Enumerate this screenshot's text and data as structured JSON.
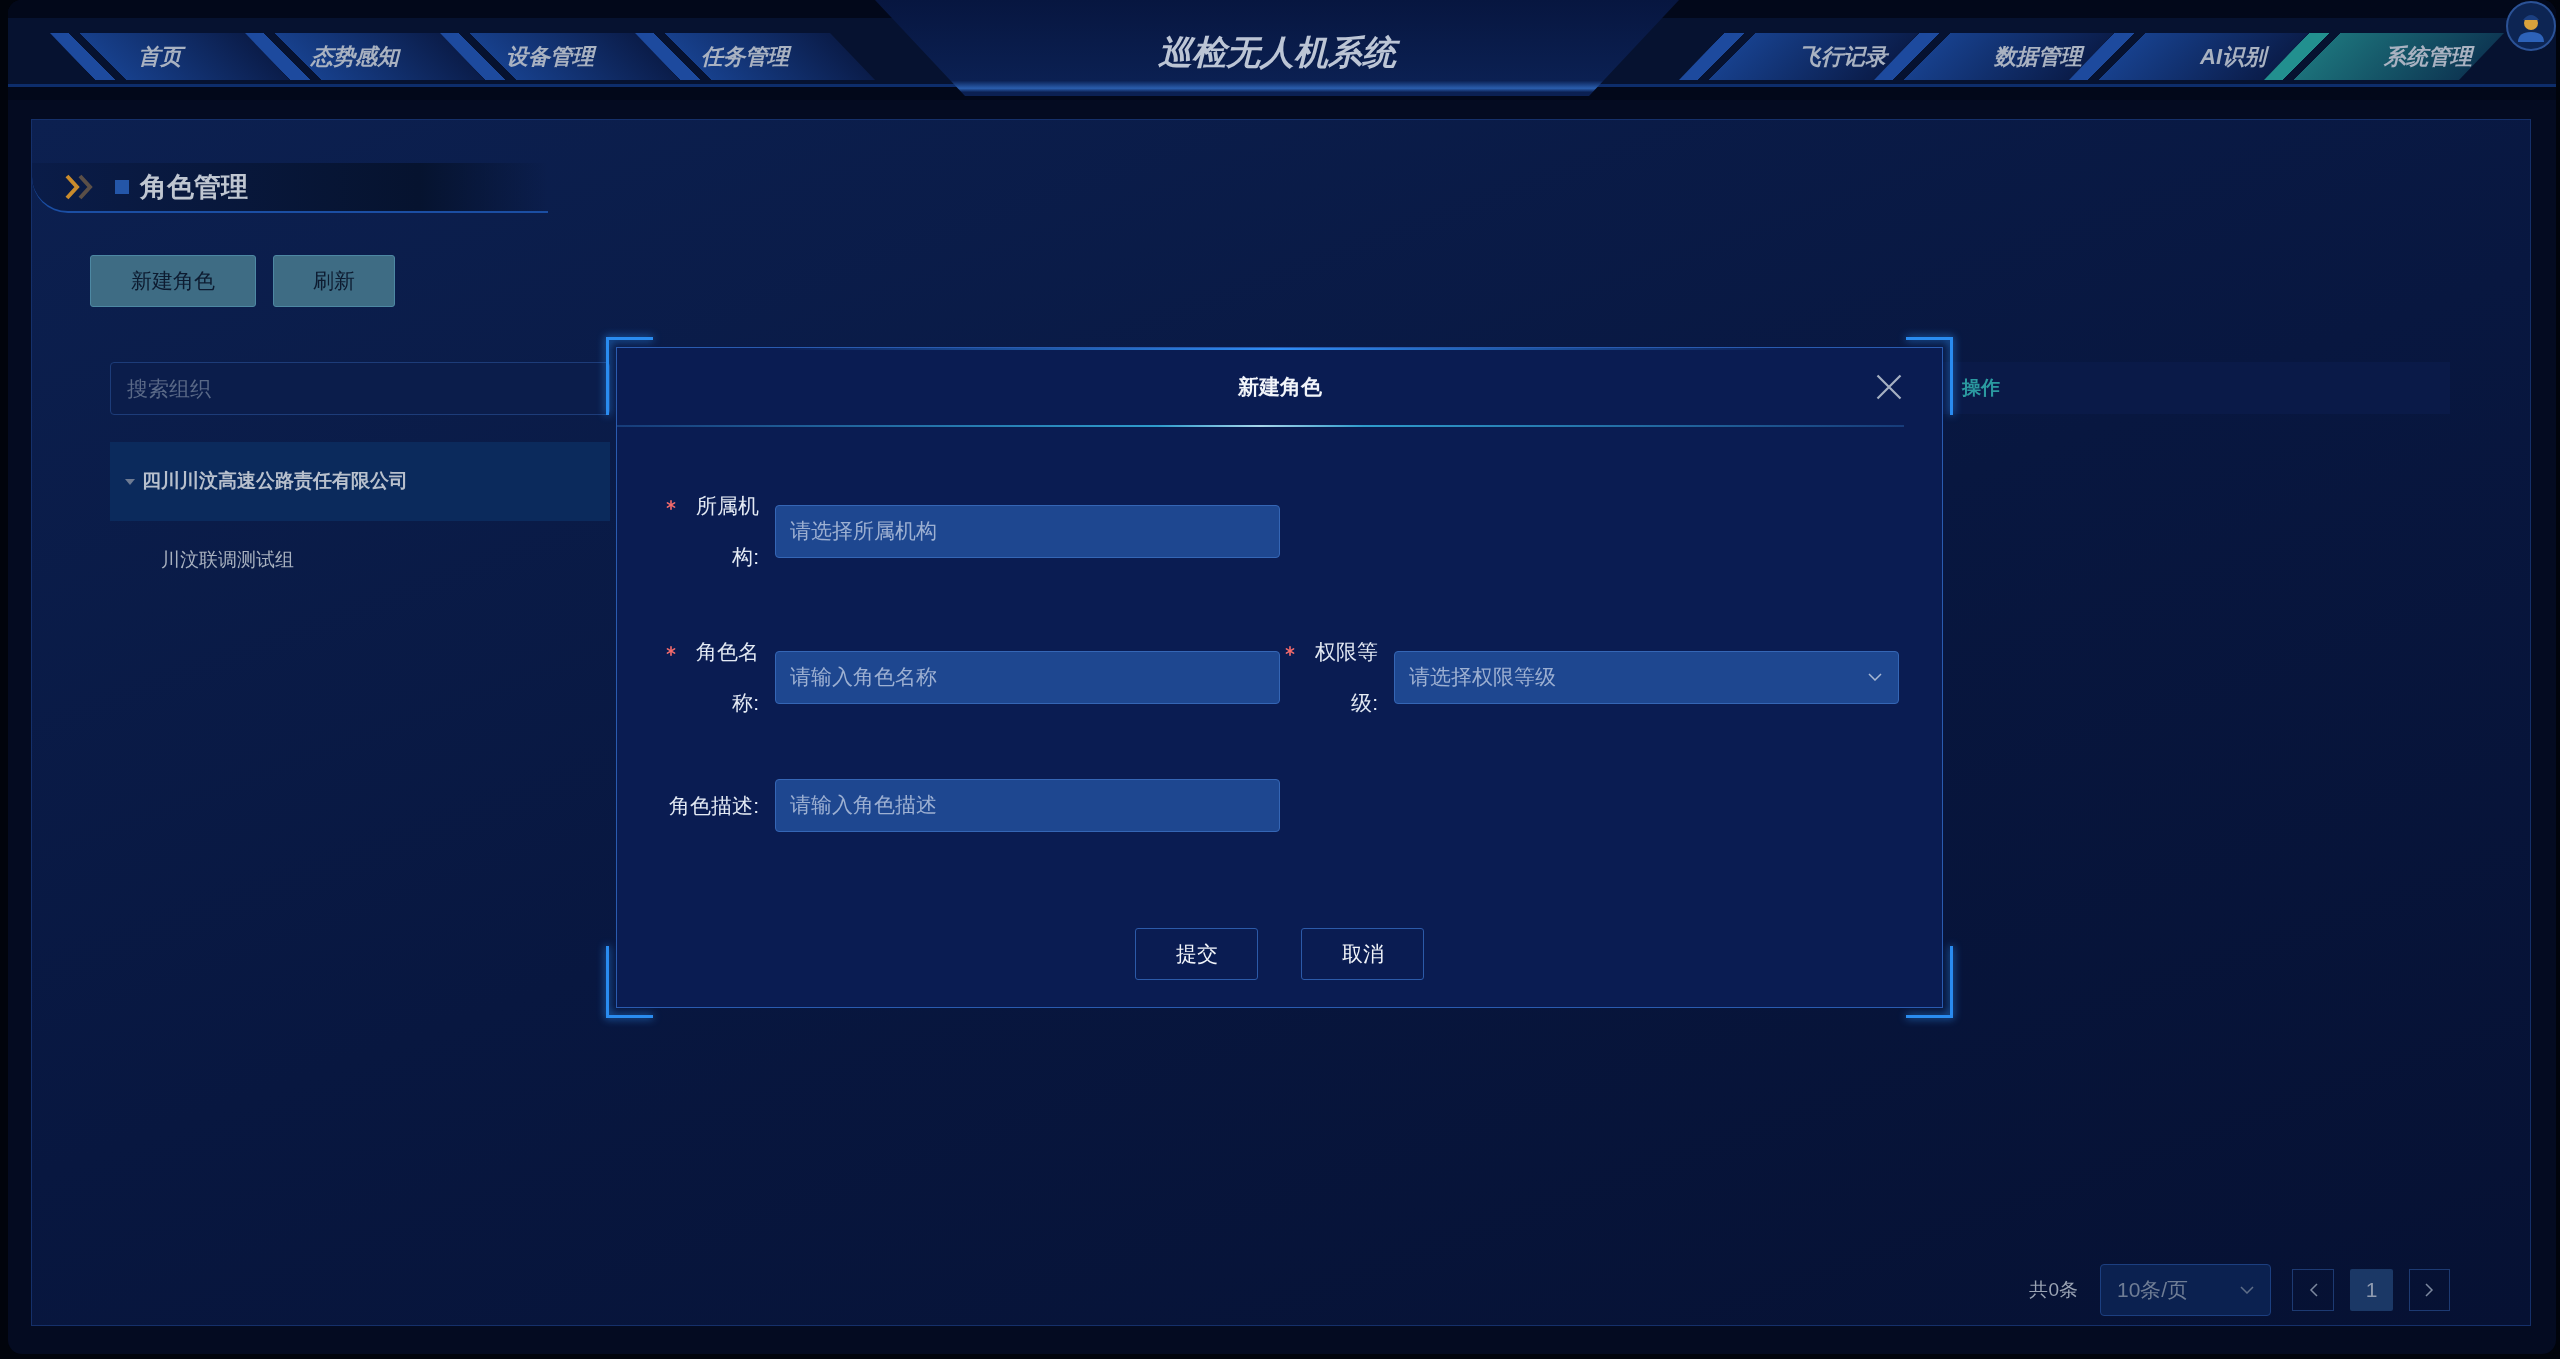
{
  "header": {
    "nav_left": [
      {
        "label": "首页",
        "selected": false
      },
      {
        "label": "态势感知",
        "selected": false
      },
      {
        "label": "设备管理",
        "selected": false
      },
      {
        "label": "任务管理",
        "selected": false
      }
    ],
    "title": "巡检无人机系统",
    "nav_right": [
      {
        "label": "飞行记录",
        "selected": false
      },
      {
        "label": "数据管理",
        "selected": false
      },
      {
        "label": "AI识别",
        "selected": false
      },
      {
        "label": "系统管理",
        "selected": true
      }
    ]
  },
  "page": {
    "title": "角色管理",
    "toolbar": [
      "新建角色",
      "刷新"
    ],
    "org_search": {
      "placeholder": "搜索组织"
    },
    "org_tree": [
      {
        "label": "四川川汶高速公路责任有限公司",
        "selected": true,
        "expanded": true,
        "children": [
          {
            "label": "川汶联调测试组",
            "selected": false
          }
        ]
      }
    ],
    "table": {
      "columns": [
        "操作"
      ]
    },
    "pagination": {
      "total": "共0条",
      "page_size": "10条/页",
      "pages": [
        {
          "label": "1",
          "selected": true
        }
      ]
    }
  },
  "dialog": {
    "title": "新建角色",
    "rows": [
      {
        "fields": [
          {
            "kind": "input",
            "label": "所属机构:",
            "required": true,
            "placeholder": "请选择所属机构"
          }
        ]
      },
      {
        "fields": [
          {
            "kind": "input",
            "label": "角色名称:",
            "required": true,
            "placeholder": "请输入角色名称"
          },
          {
            "kind": "select",
            "label": "权限等级:",
            "required": true,
            "placeholder": "请选择权限等级"
          }
        ]
      },
      {
        "fields": [
          {
            "kind": "input",
            "label": "角色描述:",
            "required": false,
            "placeholder": "请输入角色描述"
          }
        ]
      }
    ],
    "buttons": [
      "提交",
      "取消"
    ]
  }
}
